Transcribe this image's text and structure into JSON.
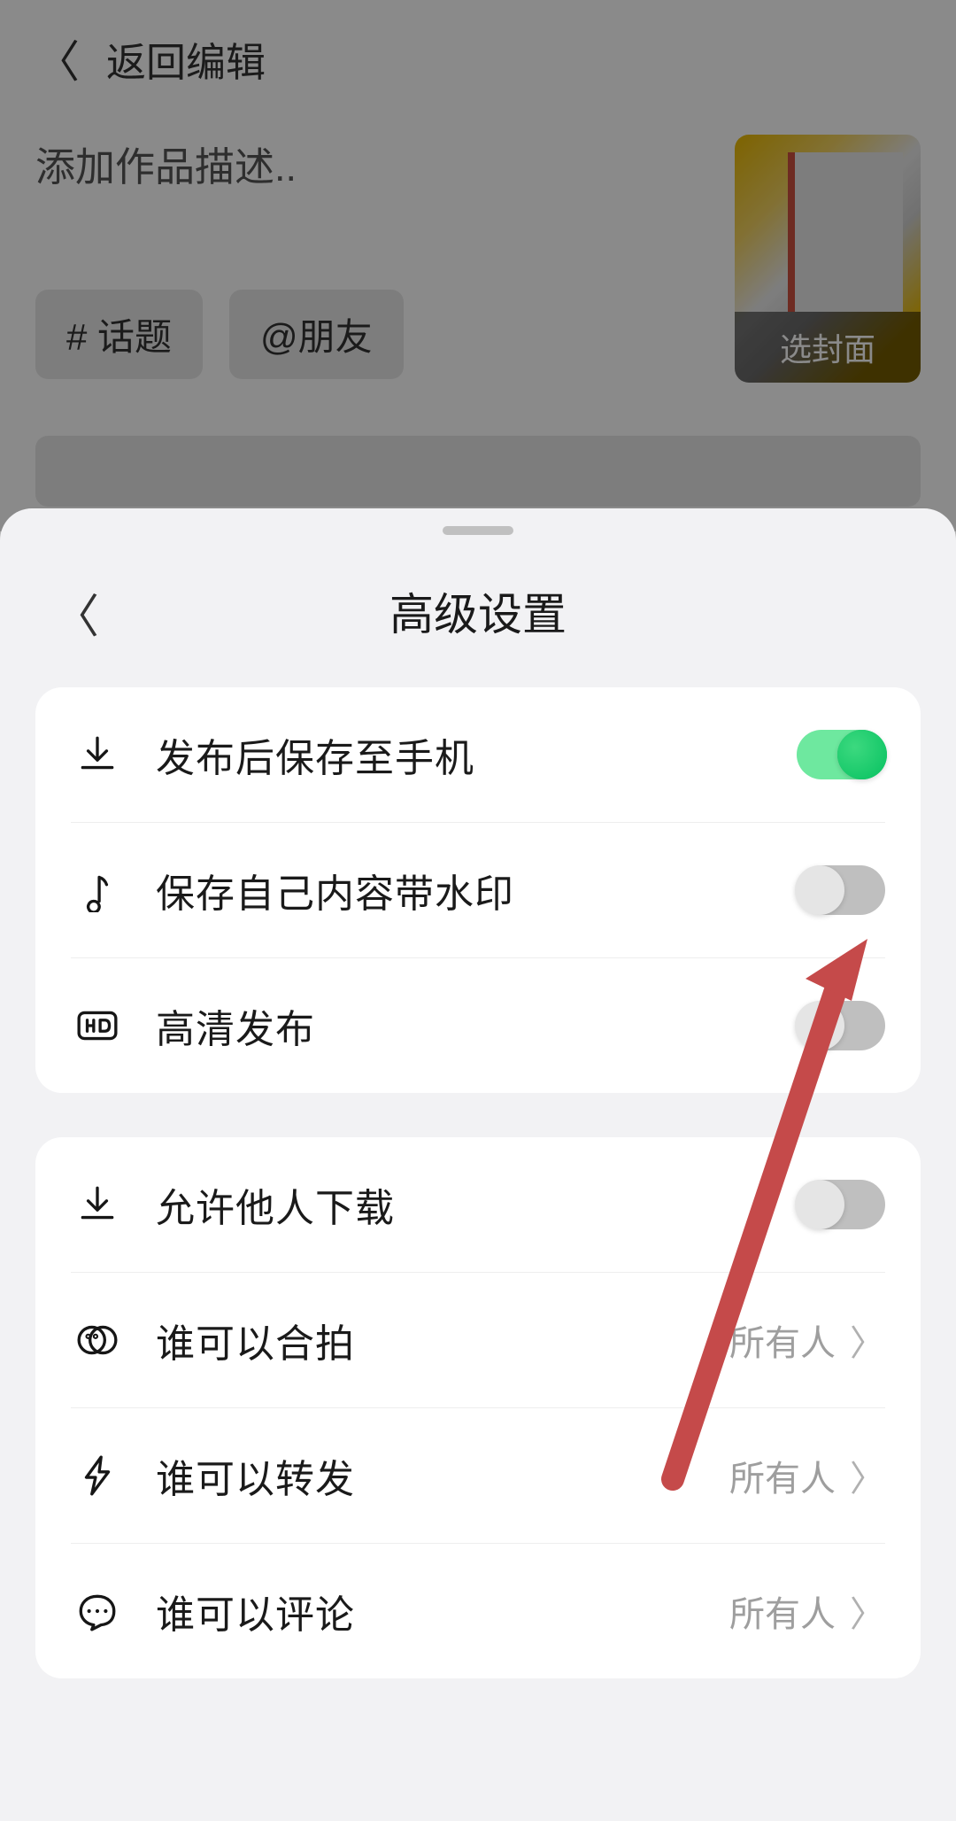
{
  "background": {
    "back_label": "返回编辑",
    "desc_placeholder": "添加作品描述..",
    "chip_topic": "# 话题",
    "chip_mention": "@朋友",
    "thumb_label": "选封面"
  },
  "sheet": {
    "title": "高级设置",
    "group1": {
      "save_to_phone": {
        "label": "发布后保存至手机",
        "on": true
      },
      "watermark": {
        "label": "保存自己内容带水印",
        "on": false
      },
      "hd_publish": {
        "label": "高清发布",
        "on": false
      }
    },
    "group2": {
      "allow_download": {
        "label": "允许他人下载",
        "on": false
      },
      "who_duet": {
        "label": "谁可以合拍",
        "value": "所有人"
      },
      "who_share": {
        "label": "谁可以转发",
        "value": "所有人"
      },
      "who_comment": {
        "label": "谁可以评论",
        "value": "所有人"
      }
    }
  }
}
